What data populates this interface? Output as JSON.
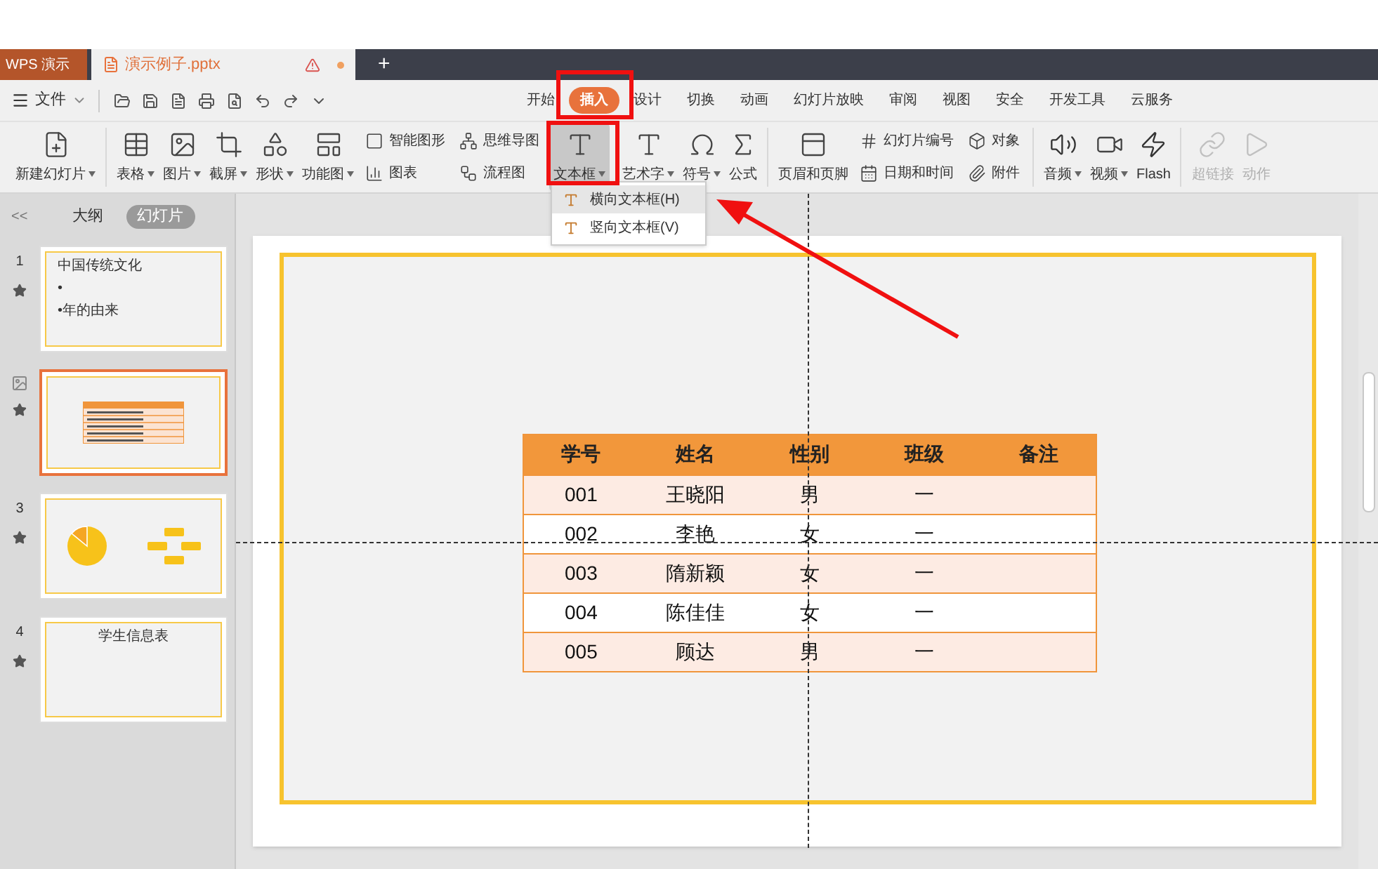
{
  "title_bar": {
    "app_tab": "WPS 演示",
    "document_tab": "演示例子.pptx",
    "new_tab": "+"
  },
  "menu_bar": {
    "file_menu": "文件",
    "tabs": [
      {
        "label": "开始",
        "selected": false
      },
      {
        "label": "插入",
        "selected": true
      },
      {
        "label": "设计",
        "selected": false
      },
      {
        "label": "切换",
        "selected": false
      },
      {
        "label": "动画",
        "selected": false
      },
      {
        "label": "幻灯片放映",
        "selected": false
      },
      {
        "label": "审阅",
        "selected": false
      },
      {
        "label": "视图",
        "selected": false
      },
      {
        "label": "安全",
        "selected": false
      },
      {
        "label": "开发工具",
        "selected": false
      },
      {
        "label": "云服务",
        "selected": false
      }
    ]
  },
  "ribbon": [
    {
      "kind": "large",
      "label": "新建幻灯片",
      "dropdown": true,
      "selected": false,
      "disabled": false
    },
    {
      "kind": "separator"
    },
    {
      "kind": "large",
      "label": "表格",
      "dropdown": true,
      "selected": false,
      "disabled": false
    },
    {
      "kind": "large",
      "label": "图片",
      "dropdown": true,
      "selected": false,
      "disabled": false
    },
    {
      "kind": "large",
      "label": "截屏",
      "dropdown": true,
      "selected": false,
      "disabled": false
    },
    {
      "kind": "large",
      "label": "形状",
      "dropdown": true,
      "selected": false,
      "disabled": false
    },
    {
      "kind": "large",
      "label": "功能图",
      "dropdown": true,
      "selected": false,
      "disabled": false
    },
    {
      "kind": "pair",
      "items": [
        "智能图形",
        "图表"
      ]
    },
    {
      "kind": "pair",
      "items": [
        "思维导图",
        "流程图"
      ]
    },
    {
      "kind": "large",
      "label": "文本框",
      "dropdown": true,
      "selected": true,
      "disabled": false
    },
    {
      "kind": "large",
      "label": "艺术字",
      "dropdown": true,
      "selected": false,
      "disabled": false
    },
    {
      "kind": "large",
      "label": "符号",
      "dropdown": true,
      "selected": false,
      "disabled": false
    },
    {
      "kind": "large",
      "label": "公式",
      "dropdown": false,
      "selected": false,
      "disabled": false
    },
    {
      "kind": "separator"
    },
    {
      "kind": "large",
      "label": "页眉和页脚",
      "dropdown": false,
      "selected": false,
      "disabled": false
    },
    {
      "kind": "pair",
      "items": [
        "幻灯片编号",
        "日期和时间"
      ]
    },
    {
      "kind": "pair",
      "items": [
        "对象",
        "附件"
      ]
    },
    {
      "kind": "separator"
    },
    {
      "kind": "large",
      "label": "音频",
      "dropdown": true,
      "selected": false,
      "disabled": false
    },
    {
      "kind": "large",
      "label": "视频",
      "dropdown": true,
      "selected": false,
      "disabled": false
    },
    {
      "kind": "large",
      "label": "Flash",
      "dropdown": false,
      "selected": false,
      "disabled": false
    },
    {
      "kind": "separator"
    },
    {
      "kind": "large",
      "label": "超链接",
      "dropdown": false,
      "selected": false,
      "disabled": true
    },
    {
      "kind": "large",
      "label": "动作",
      "dropdown": false,
      "selected": false,
      "disabled": true
    }
  ],
  "dropdown_menu": {
    "items": [
      {
        "label": "横向文本框(H)",
        "selected": true
      },
      {
        "label": "竖向文本框(V)",
        "selected": false
      }
    ]
  },
  "slide_panel": {
    "collapse": "<<",
    "views": [
      {
        "label": "大纲",
        "selected": false
      },
      {
        "label": "幻灯片",
        "selected": true
      }
    ],
    "slides": [
      {
        "number": "1",
        "kind": "text",
        "selected": false,
        "lines": [
          "中国传统文化",
          "•",
          "•年的由来"
        ]
      },
      {
        "kind": "table",
        "selected": true
      },
      {
        "number": "3",
        "kind": "chart",
        "selected": false
      },
      {
        "number": "4",
        "kind": "title",
        "selected": false,
        "lines": [
          "学生信息表"
        ]
      }
    ]
  },
  "slide": {
    "table": {
      "columns": [
        "学号",
        "姓名",
        "性别",
        "班级",
        "备注"
      ],
      "rows": [
        [
          "001",
          "王晓阳",
          "男",
          "一",
          ""
        ],
        [
          "002",
          "李艳",
          "女",
          "一",
          ""
        ],
        [
          "003",
          "隋新颖",
          "女",
          "一",
          ""
        ],
        [
          "004",
          "陈佳佳",
          "女",
          "一",
          ""
        ],
        [
          "005",
          "顾达",
          "男",
          "一",
          ""
        ]
      ]
    }
  }
}
